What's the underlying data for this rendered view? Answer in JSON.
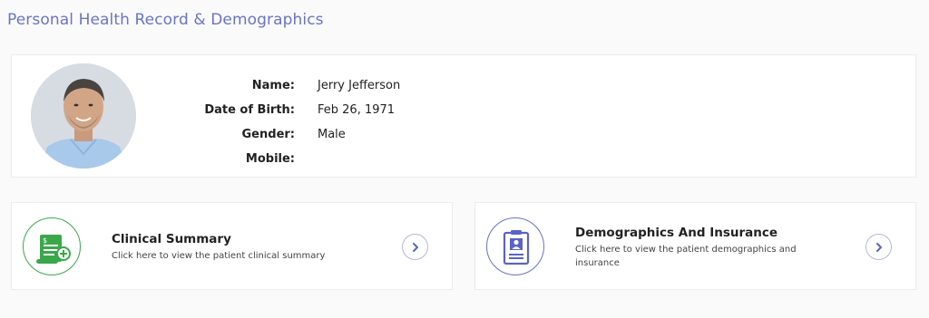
{
  "page": {
    "title": "Personal Health Record & Demographics"
  },
  "profile": {
    "fields": [
      {
        "label": "Name:",
        "value": "Jerry Jefferson"
      },
      {
        "label": "Date of Birth:",
        "value": "Feb 26, 1971"
      },
      {
        "label": "Gender:",
        "value": "Male"
      },
      {
        "label": "Mobile:",
        "value": ""
      }
    ]
  },
  "cards": [
    {
      "title": "Clinical Summary",
      "description": "Click here to view the patient clinical summary",
      "icon": "clinical-summary-icon",
      "accent": "#3aa84a"
    },
    {
      "title": "Demographics And Insurance",
      "description": "Click here to view the patient demographics and insurance",
      "icon": "id-card-clipboard-icon",
      "accent": "#6a72c8"
    }
  ],
  "colors": {
    "title": "#6b73c9",
    "arrow": "#5a63c4"
  }
}
